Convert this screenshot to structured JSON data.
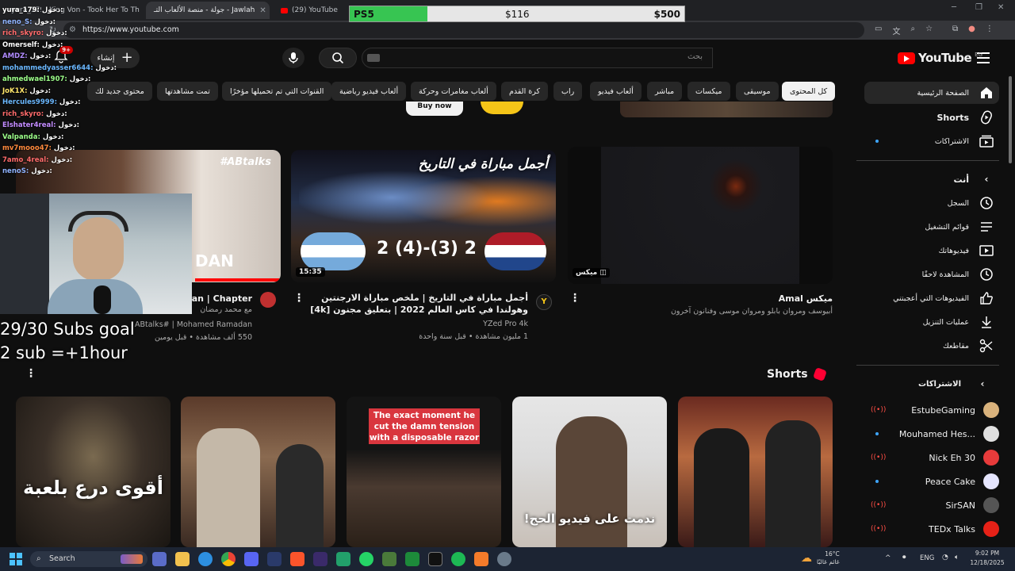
{
  "browser": {
    "tabs": [
      {
        "label": "yura_179: ...",
        "active": false
      },
      {
        "label": "King Von - Took Her To Th",
        "active": false
      },
      {
        "label": "جولة - منصة الألعاب التـ - Jawlah",
        "active": true
      },
      {
        "label": "(29) YouTube",
        "active": false
      }
    ],
    "url": "https://www.youtube.com"
  },
  "goal": {
    "left_label": "PS5",
    "current": "$116",
    "target": "$500",
    "progress": 0.232
  },
  "youtube": {
    "logo": "YouTube",
    "region": "EG",
    "search_placeholder": "بحث",
    "create_label": "إنشاء",
    "notif_count": "9+",
    "chips": [
      "كل المحتوى",
      "موسيقى",
      "ميكسات",
      "مباشر",
      "ألعاب فيديو",
      "راب",
      "كرة القدم",
      "ألعاب مغامرات وحركة",
      "ألعاب فيديو رياضية",
      "القنوات التي تم تحميلها مؤخرًا",
      "تمت مشاهدتها",
      "محتوى جديد لك"
    ],
    "promo_button": "Buy now",
    "sidebar": {
      "main": [
        {
          "label": "الصفحة الرئيسية",
          "icon": "home-icon"
        },
        {
          "label": "Shorts",
          "icon": "shorts-icon"
        },
        {
          "label": "الاشتراكات",
          "icon": "subscriptions-icon"
        }
      ],
      "you_header": "أنت",
      "you": [
        {
          "label": "السجل",
          "icon": "history-icon"
        },
        {
          "label": "قوائم التشغيل",
          "icon": "playlists-icon"
        },
        {
          "label": "فيديوهاتك",
          "icon": "your-videos-icon"
        },
        {
          "label": "المشاهدة لاحقًا",
          "icon": "watch-later-icon"
        },
        {
          "label": "الفيديوهات التي أعجبتني",
          "icon": "liked-icon"
        },
        {
          "label": "عمليات التنزيل",
          "icon": "download-icon"
        },
        {
          "label": "مقاطعك",
          "icon": "clips-icon"
        }
      ],
      "subs_header": "الاشتراكات",
      "subs": [
        {
          "name": "EstubeGaming",
          "live": true
        },
        {
          "name": "Mouhamed Hes...",
          "live": false
        },
        {
          "name": "Nick Eh 30",
          "live": true
        },
        {
          "name": "Peace Cake",
          "live": false
        },
        {
          "name": "SirSAN",
          "live": true
        },
        {
          "name": "TEDx Talks",
          "live": true
        }
      ]
    },
    "videos": [
      {
        "title": "ميكس Amal",
        "meta1": "أبيوسف ومروان بابلو ومروان موسى وفنانون آخرون",
        "meta2": "",
        "badge": "ميكس",
        "duration": ""
      },
      {
        "title": "أجمل مباراة في التاريخ | ملخص مباراة الارجنتين وهولندا في كاس العالم 2022 | بتعليق مجنون [4k]",
        "meta1": "YZed Pro 4k",
        "meta2": "1 مليون مشاهدة • قبل سنة واحدة",
        "duration": "15:35",
        "thumb_text": "أجمل مباراة في التاريخ",
        "score": "2 (4)-(3) 2"
      },
      {
        "title": "dan | Chapter",
        "meta1": "مع محمد رمضان",
        "meta2": "ABtalks# | Mohamed Ramadan",
        "meta3": "550 ألف مشاهدة • قبل يومين",
        "thumb_tag": "#ABtalks",
        "thumb_text": "DAN"
      }
    ],
    "shorts_title": "Shorts",
    "shorts": [
      {
        "text": "أقوى درع بلعبة"
      },
      {
        "text": ""
      },
      {
        "text": "The exact moment he cut the damn tension with a disposable razor"
      },
      {
        "text": "ندمت على فيديو الحج!"
      },
      {
        "text": ""
      }
    ]
  },
  "stream": {
    "goal_line1": "29/30 Subs goal",
    "goal_line2": "2 sub =+1hour",
    "chat": [
      {
        "user": "yura_179",
        "color": "#ffffff"
      },
      {
        "user": "neno_S",
        "color": "#8fb3ff"
      },
      {
        "user": "rich_skyro",
        "color": "#ff6b6b"
      },
      {
        "user": "Omerself",
        "color": "#ffffff"
      },
      {
        "user": "AMDZ",
        "color": "#b18cff"
      },
      {
        "user": "mohammedyasser6644",
        "color": "#6bb8ff"
      },
      {
        "user": "ahmedwael1907",
        "color": "#9dff8a"
      },
      {
        "user": "JoK1X",
        "color": "#ffe66b"
      },
      {
        "user": "Hercules9999",
        "color": "#6bb8ff"
      },
      {
        "user": "rich_skyro",
        "color": "#ff6b6b"
      },
      {
        "user": "Elshater4real",
        "color": "#c38cff"
      },
      {
        "user": "Valpanda",
        "color": "#9dff8a"
      },
      {
        "user": "mv7mooo47",
        "color": "#ff8a3d"
      },
      {
        "user": "7amo_4real",
        "color": "#ff6b6b"
      },
      {
        "user": "nenoS",
        "color": "#8fb3ff"
      }
    ],
    "chat_suffix": "دخول:"
  },
  "taskbar": {
    "search": "Search",
    "weather_temp": "16°C",
    "weather_desc": "غائم غالبًا",
    "lang": "ENG",
    "time": "9:02 PM",
    "date": "12/18/2025"
  }
}
